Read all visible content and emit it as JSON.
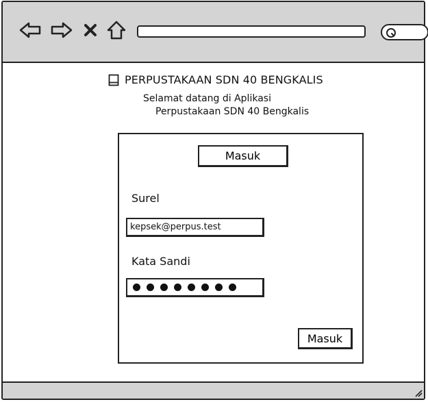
{
  "browser": {
    "back_icon": "back-arrow-icon",
    "forward_icon": "forward-arrow-icon",
    "close_icon": "close-icon",
    "home_icon": "home-icon",
    "address": "",
    "search_icon": "search-icon"
  },
  "header": {
    "title_icon": "book-icon",
    "title": "PERPUSTAKAAN SDN 40 BENGKALIS",
    "welcome_line1": "Selamat datang di Aplikasi",
    "welcome_line2": "Perpustakaan SDN 40 Bengkalis"
  },
  "login": {
    "tab_label": "Masuk",
    "email_label": "Surel",
    "email_value": "kepsek@perpus.test",
    "password_label": "Kata Sandi",
    "password_mask_count": 8,
    "submit_label": "Masuk"
  },
  "colors": {
    "chrome": "#d4d4d4",
    "stroke": "#222222",
    "background": "#ffffff"
  }
}
